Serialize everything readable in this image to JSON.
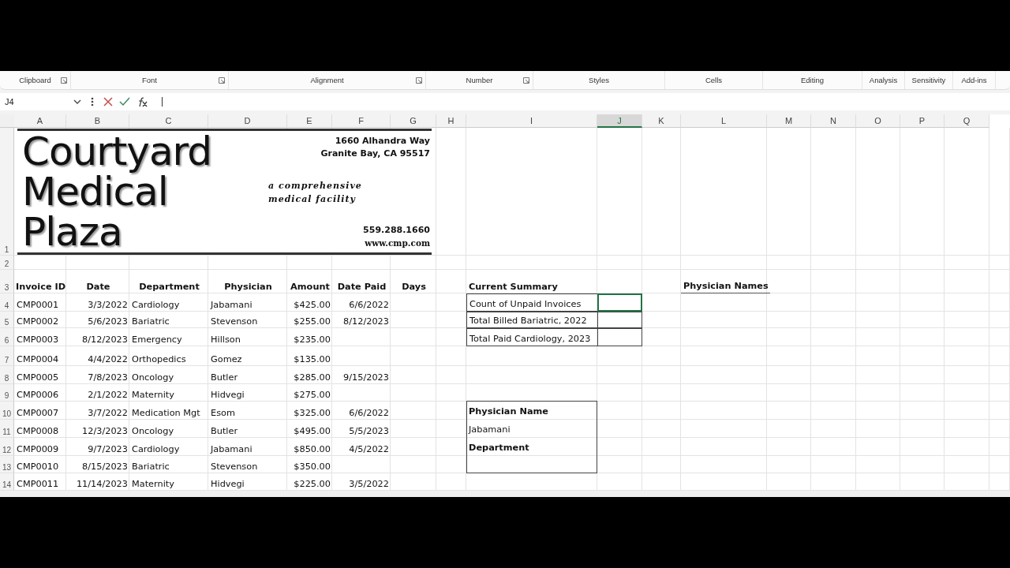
{
  "ribbon_groups": [
    {
      "label": "Clipboard",
      "launcher": true
    },
    {
      "label": "Font",
      "launcher": true
    },
    {
      "label": "Alignment",
      "launcher": true
    },
    {
      "label": "Number",
      "launcher": true
    },
    {
      "label": "Styles",
      "launcher": false
    },
    {
      "label": "Cells",
      "launcher": false
    },
    {
      "label": "Editing",
      "launcher": false
    },
    {
      "label": "Analysis",
      "launcher": false
    },
    {
      "label": "Sensitivity",
      "launcher": false
    },
    {
      "label": "Add-ins",
      "launcher": false
    }
  ],
  "formula_bar": {
    "name_box": "J4"
  },
  "columns": [
    {
      "label": "A",
      "selected": false
    },
    {
      "label": "B",
      "selected": false
    },
    {
      "label": "C",
      "selected": false
    },
    {
      "label": "D",
      "selected": false
    },
    {
      "label": "E",
      "selected": false
    },
    {
      "label": "F",
      "selected": false
    },
    {
      "label": "G",
      "selected": false
    },
    {
      "label": "H",
      "selected": false
    },
    {
      "label": "I",
      "selected": false
    },
    {
      "label": "J",
      "selected": true
    },
    {
      "label": "K",
      "selected": false
    },
    {
      "label": "L",
      "selected": false
    },
    {
      "label": "M",
      "selected": false
    },
    {
      "label": "N",
      "selected": false
    },
    {
      "label": "O",
      "selected": false
    },
    {
      "label": "P",
      "selected": false
    },
    {
      "label": "Q",
      "selected": false
    }
  ],
  "row_headers": [
    "1",
    "2",
    "3",
    "4",
    "5",
    "6",
    "7",
    "8",
    "9",
    "10",
    "11",
    "12",
    "13",
    "14"
  ],
  "logo": {
    "words": [
      "Courtyard",
      "Medical",
      "Plaza"
    ],
    "address": [
      "1660 Alhandra Way",
      "Granite Bay, CA 95517"
    ],
    "tagline": [
      "a comprehensive",
      "medical facility"
    ],
    "phone": "559.288.1660",
    "website": "www.cmp.com"
  },
  "billing": {
    "headers": [
      "Invoice ID",
      "Date",
      "Department",
      "Physician",
      "Amount",
      "Date Paid",
      "Days"
    ],
    "rows": [
      {
        "invoice_id": "CMP0001",
        "date": "3/3/2022",
        "department": "Cardiology",
        "physician": "Jabamani",
        "amount": "$425.00",
        "date_paid": "6/6/2022"
      },
      {
        "invoice_id": "CMP0002",
        "date": "5/6/2023",
        "department": "Bariatric",
        "physician": "Stevenson",
        "amount": "$255.00",
        "date_paid": "8/12/2023"
      },
      {
        "invoice_id": "CMP0003",
        "date": "8/12/2023",
        "department": "Emergency",
        "physician": "Hillson",
        "amount": "$235.00"
      },
      {
        "invoice_id": "CMP0004",
        "date": "4/4/2022",
        "department": "Orthopedics",
        "physician": "Gomez",
        "amount": "$135.00"
      },
      {
        "invoice_id": "CMP0005",
        "date": "7/8/2023",
        "department": "Oncology",
        "physician": "Butler",
        "amount": "$285.00",
        "date_paid": "9/15/2023"
      },
      {
        "invoice_id": "CMP0006",
        "date": "2/1/2022",
        "department": "Maternity",
        "physician": "Hidvegi",
        "amount": "$275.00"
      },
      {
        "invoice_id": "CMP0007",
        "date": "3/7/2022",
        "department": "Medication Mgt",
        "physician": "Esom",
        "amount": "$325.00",
        "date_paid": "6/6/2022"
      },
      {
        "invoice_id": "CMP0008",
        "date": "12/3/2023",
        "department": "Oncology",
        "physician": "Butler",
        "amount": "$495.00",
        "date_paid": "5/5/2023"
      },
      {
        "invoice_id": "CMP0009",
        "date": "9/7/2023",
        "department": "Cardiology",
        "physician": "Jabamani",
        "amount": "$850.00",
        "date_paid": "4/5/2022"
      },
      {
        "invoice_id": "CMP0010",
        "date": "8/15/2023",
        "department": "Bariatric",
        "physician": "Stevenson",
        "amount": "$350.00"
      },
      {
        "invoice_id": "CMP0011",
        "date": "11/14/2023",
        "department": "Maternity",
        "physician": "Hidvegi",
        "amount": "$225.00",
        "date_paid": "3/5/2022"
      }
    ]
  },
  "current_summary": {
    "title": "Current Summary",
    "items": [
      {
        "label": "Count of Unpaid Invoices",
        "selected": true
      },
      {
        "label": "Total Billed Bariatric, 2022",
        "selected": false
      },
      {
        "label": "Total Paid Cardiology, 2023",
        "selected": false
      }
    ]
  },
  "physician_lookup": {
    "lines": [
      {
        "text": "Physician Name",
        "bold": true
      },
      {
        "text": "Jabamani",
        "bold": false
      },
      {
        "text": "Department",
        "bold": true
      }
    ]
  },
  "physician_names": {
    "heading": "Physician Names"
  }
}
